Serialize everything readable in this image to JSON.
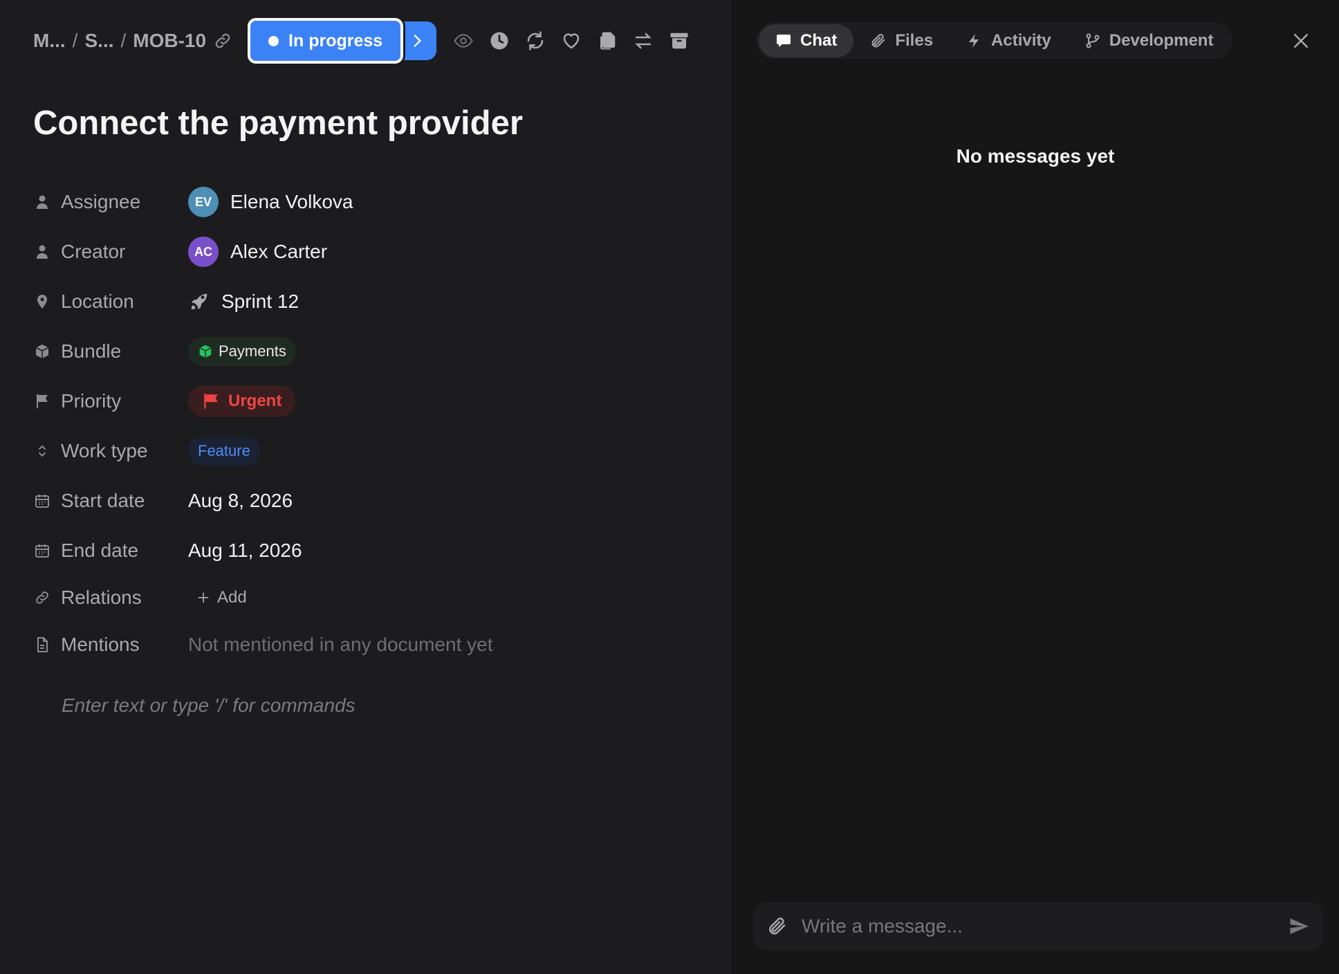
{
  "breadcrumb": {
    "project": "M...",
    "section": "S...",
    "issue_id": "MOB-10"
  },
  "status": {
    "label": "In progress",
    "color": "#3b82f6"
  },
  "toolbar_icons": [
    "eye-icon",
    "clock-icon",
    "refresh-icon",
    "heart-icon",
    "copy-icon",
    "swap-icon",
    "archive-icon"
  ],
  "title": "Connect the payment provider",
  "properties": {
    "assignee": {
      "label": "Assignee",
      "initials": "EV",
      "name": "Elena Volkova",
      "avatar_color": "#4d8fb5"
    },
    "creator": {
      "label": "Creator",
      "initials": "AC",
      "name": "Alex Carter",
      "avatar_color": "#7b4fc9"
    },
    "location": {
      "label": "Location",
      "value": "Sprint 12"
    },
    "bundle": {
      "label": "Bundle",
      "value": "Payments"
    },
    "priority": {
      "label": "Priority",
      "value": "Urgent",
      "color": "#ef4444"
    },
    "work_type": {
      "label": "Work type",
      "value": "Feature"
    },
    "start_date": {
      "label": "Start date",
      "value": "Aug 8, 2026"
    },
    "end_date": {
      "label": "End date",
      "value": "Aug 11, 2026"
    },
    "relations": {
      "label": "Relations",
      "add": "Add"
    },
    "mentions": {
      "label": "Mentions",
      "value": "Not mentioned in any document yet"
    }
  },
  "editor": {
    "placeholder": "Enter text or type '/' for commands"
  },
  "panel": {
    "tabs": [
      {
        "label": "Chat",
        "icon": "chat-icon",
        "active": true
      },
      {
        "label": "Files",
        "icon": "paperclip-icon",
        "active": false
      },
      {
        "label": "Activity",
        "icon": "lightning-icon",
        "active": false
      },
      {
        "label": "Development",
        "icon": "branch-icon",
        "active": false
      }
    ],
    "empty_text": "No messages yet",
    "composer_placeholder": "Write a message..."
  }
}
